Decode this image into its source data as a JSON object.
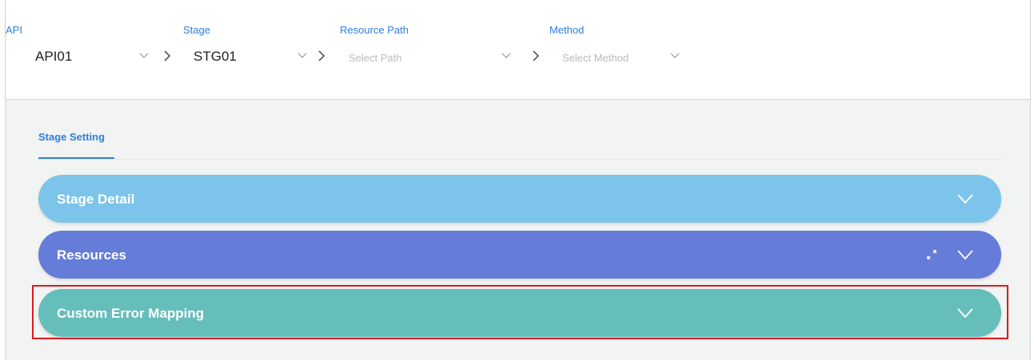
{
  "selectors": {
    "api": {
      "label": "API",
      "value": "API01"
    },
    "stage": {
      "label": "Stage",
      "value": "STG01"
    },
    "resource_path": {
      "label": "Resource Path",
      "placeholder": "Select Path"
    },
    "method": {
      "label": "Method",
      "placeholder": "Select Method"
    }
  },
  "tabs": [
    {
      "label": "Stage Setting",
      "active": true
    }
  ],
  "panels": [
    {
      "title": "Stage Detail",
      "color": "#7cc4e9",
      "icons": [
        "chevron-down-icon"
      ]
    },
    {
      "title": "Resources",
      "color": "#657cd8",
      "icons": [
        "expand-arrows-icon",
        "chevron-down-icon"
      ]
    },
    {
      "title": "Custom Error Mapping",
      "color": "#66bebb",
      "icons": [
        "chevron-down-icon"
      ],
      "highlighted": true
    }
  ],
  "colors": {
    "accent": "#2d7fe0",
    "highlight_border": "#e0191c",
    "content_bg": "#f2f3f3"
  }
}
